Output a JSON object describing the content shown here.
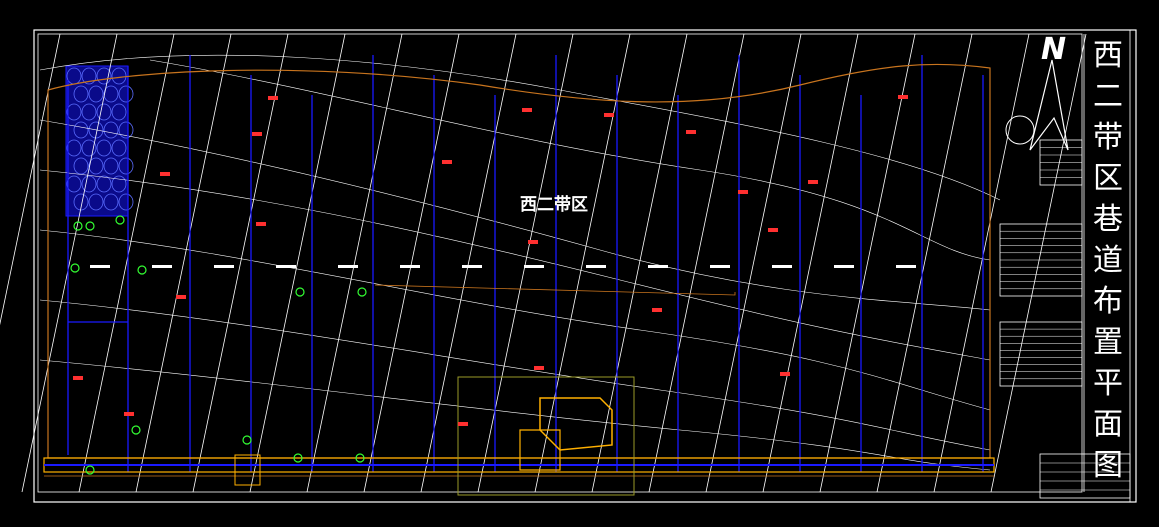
{
  "drawing": {
    "title": "西二带区巷道布置平面图",
    "area_label": "西二带区",
    "north_label": "N"
  },
  "colors": {
    "background": "#000000",
    "frame": "#ffffff",
    "contour": "#ffffff",
    "roadway": "#1a1aff",
    "boundary": "#c8741e",
    "conveyor": "#ffb000",
    "marker": "#ff3030",
    "station": "#33ff33",
    "facility_outline": "#9a9a28"
  },
  "layers": {
    "grid_lines": "contour-lines",
    "panel_roadways": "blue-roadways",
    "boundary": "orange-boundary",
    "main_roadway": "bottom-main-roadway",
    "facility": "central-facility",
    "goaf": "mined-out-area"
  }
}
